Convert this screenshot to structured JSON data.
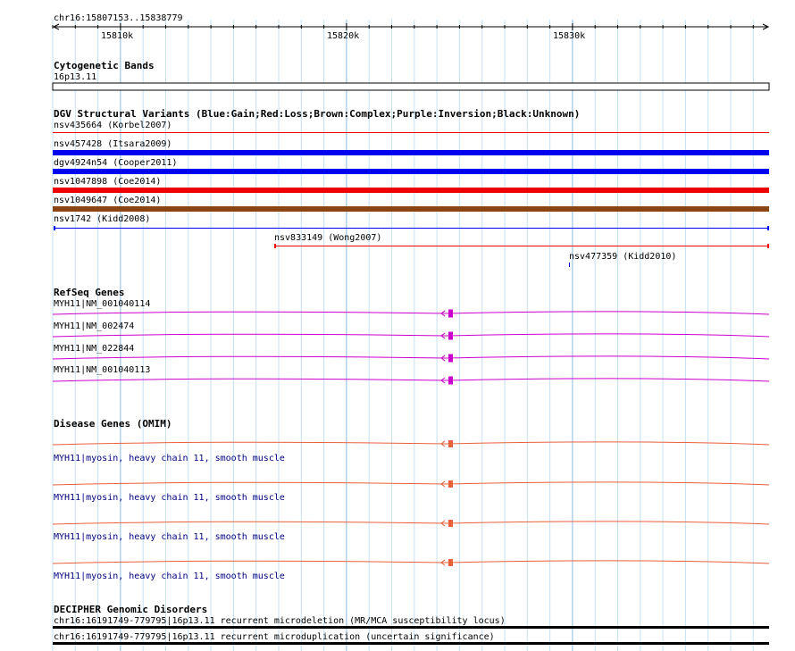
{
  "ruler": {
    "location": "chr16:15807153..15838779",
    "ticks": [
      "15810k",
      "15820k",
      "15830k"
    ]
  },
  "cytobands": {
    "title": "Cytogenetic Bands",
    "band": "16p13.11"
  },
  "dgv": {
    "title": "DGV Structural Variants (Blue:Gain;Red:Loss;Brown:Complex;Purple:Inversion;Black:Unknown)",
    "colors": {
      "gain": "#0000ee",
      "loss": "#ee0000",
      "complex": "#8b4513",
      "unknown": "#000000"
    },
    "variants": [
      {
        "label": "nsv435664 (Korbel2007)",
        "type": "loss"
      },
      {
        "label": "nsv457428 (Itsara2009)",
        "type": "gain"
      },
      {
        "label": "dgv4924n54 (Cooper2011)",
        "type": "gain"
      },
      {
        "label": "nsv1047898 (Coe2014)",
        "type": "loss"
      },
      {
        "label": "nsv1049647 (Coe2014)",
        "type": "complex"
      },
      {
        "label": "nsv1742 (Kidd2008)",
        "type": "gain"
      },
      {
        "label": "nsv833149 (Wong2007)",
        "type": "loss"
      },
      {
        "label": "nsv477359 (Kidd2010)",
        "type": "gain"
      }
    ]
  },
  "refseq": {
    "title": "RefSeq Genes",
    "color": "#cc00cc",
    "genes": [
      "MYH11|NM_001040114",
      "MYH11|NM_002474",
      "MYH11|NM_022844",
      "MYH11|NM_001040113"
    ]
  },
  "omim": {
    "title": "Disease Genes (OMIM)",
    "color": "#e8603c",
    "genes": [
      "MYH11|myosin, heavy chain 11, smooth muscle",
      "MYH11|myosin, heavy chain 11, smooth muscle",
      "MYH11|myosin, heavy chain 11, smooth muscle",
      "MYH11|myosin, heavy chain 11, smooth muscle"
    ]
  },
  "decipher": {
    "title": "DECIPHER Genomic Disorders",
    "items": [
      "chr16:16191749-779795|16p13.11 recurrent microdeletion (MR/MCA susceptibility locus)",
      "chr16:16191749-779795|16p13.11 recurrent microduplication (uncertain significance)"
    ]
  }
}
